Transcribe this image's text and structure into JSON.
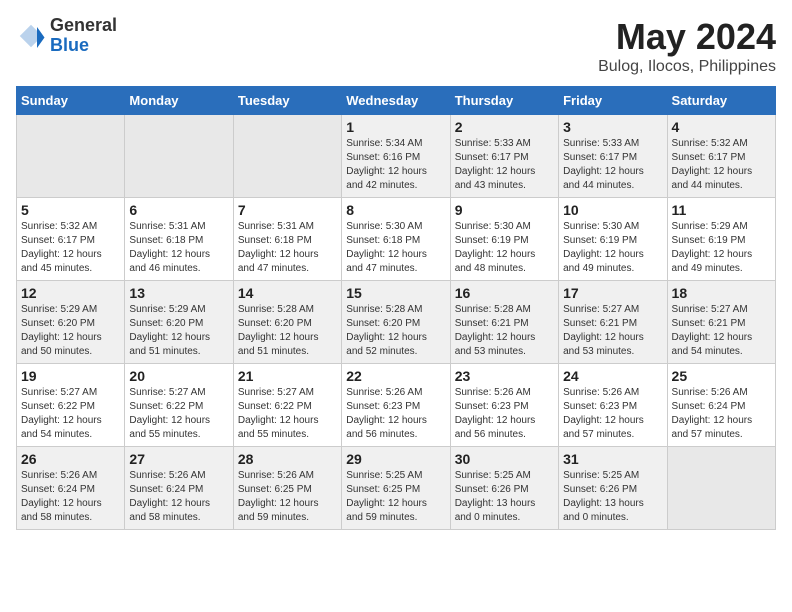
{
  "header": {
    "logo_general": "General",
    "logo_blue": "Blue",
    "month_year": "May 2024",
    "location": "Bulog, Ilocos, Philippines"
  },
  "weekdays": [
    "Sunday",
    "Monday",
    "Tuesday",
    "Wednesday",
    "Thursday",
    "Friday",
    "Saturday"
  ],
  "weeks": [
    [
      {
        "day": "",
        "info": ""
      },
      {
        "day": "",
        "info": ""
      },
      {
        "day": "",
        "info": ""
      },
      {
        "day": "1",
        "info": "Sunrise: 5:34 AM\nSunset: 6:16 PM\nDaylight: 12 hours\nand 42 minutes."
      },
      {
        "day": "2",
        "info": "Sunrise: 5:33 AM\nSunset: 6:17 PM\nDaylight: 12 hours\nand 43 minutes."
      },
      {
        "day": "3",
        "info": "Sunrise: 5:33 AM\nSunset: 6:17 PM\nDaylight: 12 hours\nand 44 minutes."
      },
      {
        "day": "4",
        "info": "Sunrise: 5:32 AM\nSunset: 6:17 PM\nDaylight: 12 hours\nand 44 minutes."
      }
    ],
    [
      {
        "day": "5",
        "info": "Sunrise: 5:32 AM\nSunset: 6:17 PM\nDaylight: 12 hours\nand 45 minutes."
      },
      {
        "day": "6",
        "info": "Sunrise: 5:31 AM\nSunset: 6:18 PM\nDaylight: 12 hours\nand 46 minutes."
      },
      {
        "day": "7",
        "info": "Sunrise: 5:31 AM\nSunset: 6:18 PM\nDaylight: 12 hours\nand 47 minutes."
      },
      {
        "day": "8",
        "info": "Sunrise: 5:30 AM\nSunset: 6:18 PM\nDaylight: 12 hours\nand 47 minutes."
      },
      {
        "day": "9",
        "info": "Sunrise: 5:30 AM\nSunset: 6:19 PM\nDaylight: 12 hours\nand 48 minutes."
      },
      {
        "day": "10",
        "info": "Sunrise: 5:30 AM\nSunset: 6:19 PM\nDaylight: 12 hours\nand 49 minutes."
      },
      {
        "day": "11",
        "info": "Sunrise: 5:29 AM\nSunset: 6:19 PM\nDaylight: 12 hours\nand 49 minutes."
      }
    ],
    [
      {
        "day": "12",
        "info": "Sunrise: 5:29 AM\nSunset: 6:20 PM\nDaylight: 12 hours\nand 50 minutes."
      },
      {
        "day": "13",
        "info": "Sunrise: 5:29 AM\nSunset: 6:20 PM\nDaylight: 12 hours\nand 51 minutes."
      },
      {
        "day": "14",
        "info": "Sunrise: 5:28 AM\nSunset: 6:20 PM\nDaylight: 12 hours\nand 51 minutes."
      },
      {
        "day": "15",
        "info": "Sunrise: 5:28 AM\nSunset: 6:20 PM\nDaylight: 12 hours\nand 52 minutes."
      },
      {
        "day": "16",
        "info": "Sunrise: 5:28 AM\nSunset: 6:21 PM\nDaylight: 12 hours\nand 53 minutes."
      },
      {
        "day": "17",
        "info": "Sunrise: 5:27 AM\nSunset: 6:21 PM\nDaylight: 12 hours\nand 53 minutes."
      },
      {
        "day": "18",
        "info": "Sunrise: 5:27 AM\nSunset: 6:21 PM\nDaylight: 12 hours\nand 54 minutes."
      }
    ],
    [
      {
        "day": "19",
        "info": "Sunrise: 5:27 AM\nSunset: 6:22 PM\nDaylight: 12 hours\nand 54 minutes."
      },
      {
        "day": "20",
        "info": "Sunrise: 5:27 AM\nSunset: 6:22 PM\nDaylight: 12 hours\nand 55 minutes."
      },
      {
        "day": "21",
        "info": "Sunrise: 5:27 AM\nSunset: 6:22 PM\nDaylight: 12 hours\nand 55 minutes."
      },
      {
        "day": "22",
        "info": "Sunrise: 5:26 AM\nSunset: 6:23 PM\nDaylight: 12 hours\nand 56 minutes."
      },
      {
        "day": "23",
        "info": "Sunrise: 5:26 AM\nSunset: 6:23 PM\nDaylight: 12 hours\nand 56 minutes."
      },
      {
        "day": "24",
        "info": "Sunrise: 5:26 AM\nSunset: 6:23 PM\nDaylight: 12 hours\nand 57 minutes."
      },
      {
        "day": "25",
        "info": "Sunrise: 5:26 AM\nSunset: 6:24 PM\nDaylight: 12 hours\nand 57 minutes."
      }
    ],
    [
      {
        "day": "26",
        "info": "Sunrise: 5:26 AM\nSunset: 6:24 PM\nDaylight: 12 hours\nand 58 minutes."
      },
      {
        "day": "27",
        "info": "Sunrise: 5:26 AM\nSunset: 6:24 PM\nDaylight: 12 hours\nand 58 minutes."
      },
      {
        "day": "28",
        "info": "Sunrise: 5:26 AM\nSunset: 6:25 PM\nDaylight: 12 hours\nand 59 minutes."
      },
      {
        "day": "29",
        "info": "Sunrise: 5:25 AM\nSunset: 6:25 PM\nDaylight: 12 hours\nand 59 minutes."
      },
      {
        "day": "30",
        "info": "Sunrise: 5:25 AM\nSunset: 6:26 PM\nDaylight: 13 hours\nand 0 minutes."
      },
      {
        "day": "31",
        "info": "Sunrise: 5:25 AM\nSunset: 6:26 PM\nDaylight: 13 hours\nand 0 minutes."
      },
      {
        "day": "",
        "info": ""
      }
    ]
  ]
}
